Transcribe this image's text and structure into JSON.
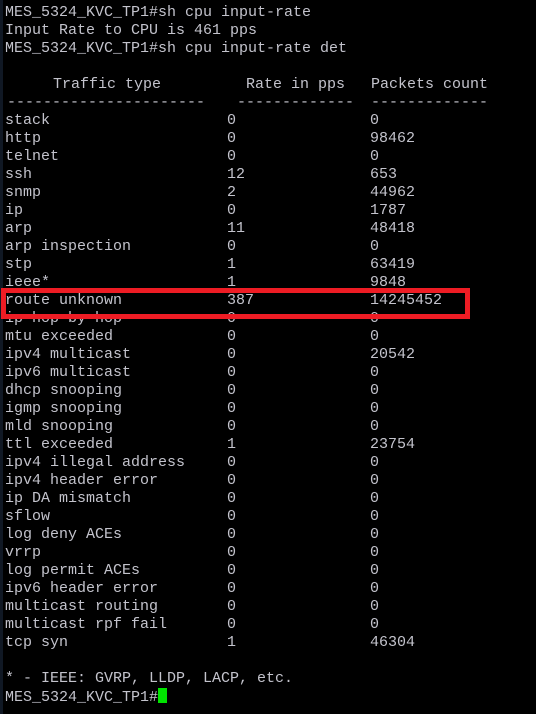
{
  "terminal": {
    "prompt": "MES_5324_KVC_TP1#",
    "colors": {
      "background": "#000000",
      "text": "#c3c3cc",
      "cursor": "#00e400",
      "highlight_box": "#ee1c24",
      "left_strip": "#101824"
    }
  },
  "session": {
    "command_1": "MES_5324_KVC_TP1#sh cpu input-rate",
    "output_1": "Input Rate to CPU is 461 pps",
    "command_2": "MES_5324_KVC_TP1#sh cpu input-rate det",
    "footnote": "* - IEEE: GVRP, LLDP, LACP, etc.",
    "final_prompt": "MES_5324_KVC_TP1#"
  },
  "table": {
    "headers": {
      "traffic_type": "Traffic type",
      "rate": "Rate in pps",
      "packets": "Packets count"
    },
    "separators": {
      "traffic_type": "----------------------",
      "rate": "-------------",
      "packets": "-------------"
    },
    "rows": [
      {
        "name": "stack",
        "rate": "0",
        "packets": "0"
      },
      {
        "name": "http",
        "rate": "0",
        "packets": "98462"
      },
      {
        "name": "telnet",
        "rate": "0",
        "packets": "0"
      },
      {
        "name": "ssh",
        "rate": "12",
        "packets": "653"
      },
      {
        "name": "snmp",
        "rate": "2",
        "packets": "44962"
      },
      {
        "name": "ip",
        "rate": "0",
        "packets": "1787"
      },
      {
        "name": "arp",
        "rate": "11",
        "packets": "48418"
      },
      {
        "name": "arp inspection",
        "rate": "0",
        "packets": "0"
      },
      {
        "name": "stp",
        "rate": "1",
        "packets": "63419"
      },
      {
        "name": "ieee*",
        "rate": "1",
        "packets": "9848"
      },
      {
        "name": "route unknown",
        "rate": "387",
        "packets": "14245452"
      },
      {
        "name": "ip hop by hop",
        "rate": "0",
        "packets": "0"
      },
      {
        "name": "mtu exceeded",
        "rate": "0",
        "packets": "0"
      },
      {
        "name": "ipv4 multicast",
        "rate": "0",
        "packets": "20542"
      },
      {
        "name": "ipv6 multicast",
        "rate": "0",
        "packets": "0"
      },
      {
        "name": "dhcp snooping",
        "rate": "0",
        "packets": "0"
      },
      {
        "name": "igmp snooping",
        "rate": "0",
        "packets": "0"
      },
      {
        "name": "mld snooping",
        "rate": "0",
        "packets": "0"
      },
      {
        "name": "ttl exceeded",
        "rate": "1",
        "packets": "23754"
      },
      {
        "name": "ipv4 illegal address",
        "rate": "0",
        "packets": "0"
      },
      {
        "name": "ipv4 header error",
        "rate": "0",
        "packets": "0"
      },
      {
        "name": "ip DA mismatch",
        "rate": "0",
        "packets": "0"
      },
      {
        "name": "sflow",
        "rate": "0",
        "packets": "0"
      },
      {
        "name": "log deny ACEs",
        "rate": "0",
        "packets": "0"
      },
      {
        "name": "vrrp",
        "rate": "0",
        "packets": "0"
      },
      {
        "name": "log permit ACEs",
        "rate": "0",
        "packets": "0"
      },
      {
        "name": "ipv6 header error",
        "rate": "0",
        "packets": "0"
      },
      {
        "name": "multicast routing",
        "rate": "0",
        "packets": "0"
      },
      {
        "name": "multicast rpf fail",
        "rate": "0",
        "packets": "0"
      },
      {
        "name": "tcp syn",
        "rate": "1",
        "packets": "46304"
      }
    ],
    "highlighted_row_index": 10
  }
}
